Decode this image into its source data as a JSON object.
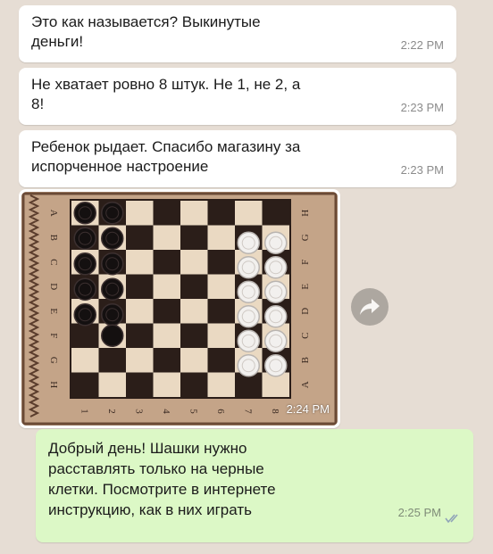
{
  "messages": [
    {
      "text": "Это как называется? Выкинутые\nденьги!",
      "time": "2:22 PM"
    },
    {
      "text": "Не хватает ровно 8 штук. Не 1, не 2, а\n8!",
      "time": "2:23 PM"
    },
    {
      "text": "Ребенок рыдает. Спасибо магазину за\nиспорченное настроение",
      "time": "2:23 PM"
    },
    {
      "image": "checkers-board-photo",
      "time": "2:24 PM"
    },
    {
      "text": "Добрый день! Шашки нужно\nрасставлять только на черные\nклетки. Посмотрите в интернете\nинструкцию, как в них играть",
      "time": "2:25 PM",
      "status_icon": "double-check-icon"
    }
  ],
  "board": {
    "rank_labels": [
      "A",
      "B",
      "C",
      "D",
      "E",
      "F",
      "G",
      "H"
    ],
    "file_labels": [
      "1",
      "2",
      "3",
      "4",
      "5",
      "6",
      "7",
      "8"
    ]
  },
  "forward_icon": "forward-arrow-icon",
  "colors": {
    "incoming": "#ffffff",
    "outgoing": "#dcf8c6",
    "background": "#e6ddd4"
  }
}
